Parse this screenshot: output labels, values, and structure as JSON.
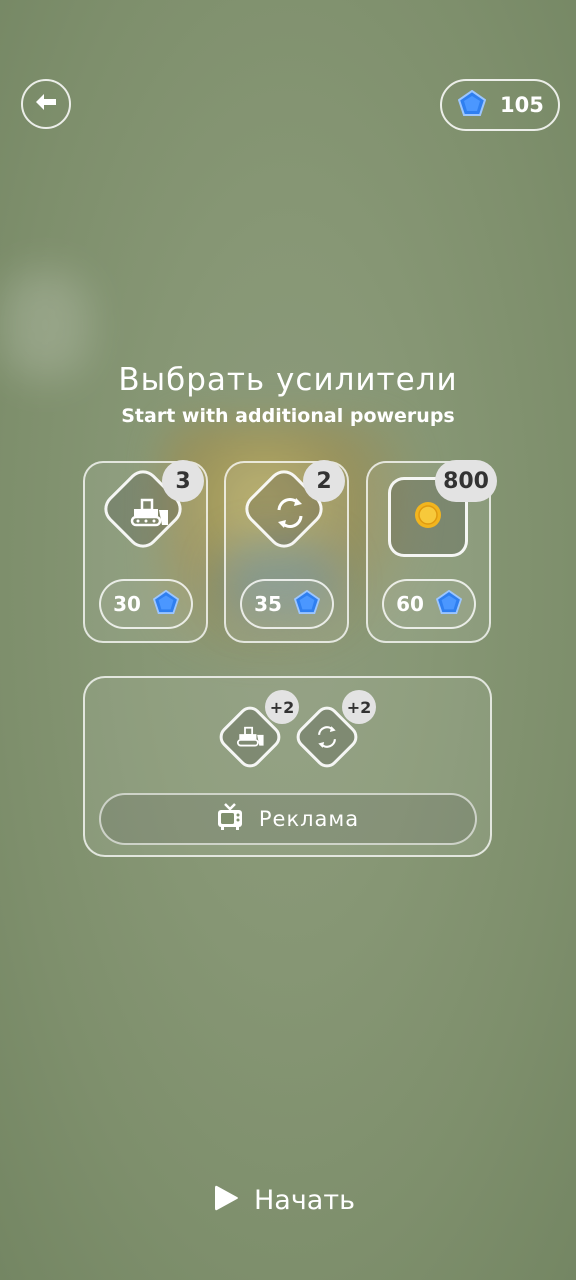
{
  "header": {
    "gem_count": "105"
  },
  "title": "Выбрать усилители",
  "subtitle": "Start with additional powerups",
  "powerups": [
    {
      "icon": "bulldozer-icon",
      "count": "3",
      "price": "30"
    },
    {
      "icon": "shuffle-icon",
      "count": "2",
      "price": "35"
    },
    {
      "icon": "coin-icon",
      "count": "800",
      "price": "60"
    }
  ],
  "bonus": {
    "items": [
      {
        "icon": "bulldozer-icon",
        "plus": "+2"
      },
      {
        "icon": "shuffle-icon",
        "plus": "+2"
      }
    ],
    "ad_label": "Реклама"
  },
  "start_label": "Начать",
  "colors": {
    "gem": "#2f7ff0",
    "coin": "#f2b51e",
    "badge": "#e3e3e3"
  }
}
